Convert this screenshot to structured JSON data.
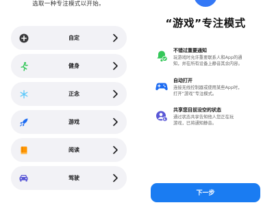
{
  "left": {
    "subtitle": "选取一种专注模式以开始。",
    "items": [
      {
        "label": "自定",
        "icon": "plus-circle-icon",
        "color": "#3a3a3c"
      },
      {
        "label": "健身",
        "icon": "running-figure-icon",
        "color": "#34c759"
      },
      {
        "label": "正念",
        "icon": "snowflake-icon",
        "color": "#5ac8fa"
      },
      {
        "label": "游戏",
        "icon": "rocket-icon",
        "color": "#1d6cf2"
      },
      {
        "label": "阅读",
        "icon": "book-icon",
        "color": "#ff9500"
      },
      {
        "label": "驾驶",
        "icon": "car-icon",
        "color": "#5856d6"
      }
    ]
  },
  "right": {
    "title": "“游戏”专注模式",
    "features": [
      {
        "title": "不错过重要通知",
        "body_line1": "玩游戏时允许重要联系人和App的通",
        "body_line2": "知，并在所有设备上静音其余内容。",
        "icon": "bell-check-icon",
        "color": "#34c759"
      },
      {
        "title": "自动打开",
        "body_line1": "连接无线控制器或使用某些App时，",
        "body_line2": "打开“游戏”专注模式。",
        "icon": "gamepad-icon",
        "color": "#1d6cf2"
      },
      {
        "title": "共享您目前没空的状态",
        "body_line1": "通过状态共享告知他人您正在玩",
        "body_line2": "游戏，已将通知静音。",
        "icon": "status-share-icon",
        "color": "#5856d6"
      }
    ],
    "next_label": "下一步",
    "accent": "#1a7cf2"
  }
}
